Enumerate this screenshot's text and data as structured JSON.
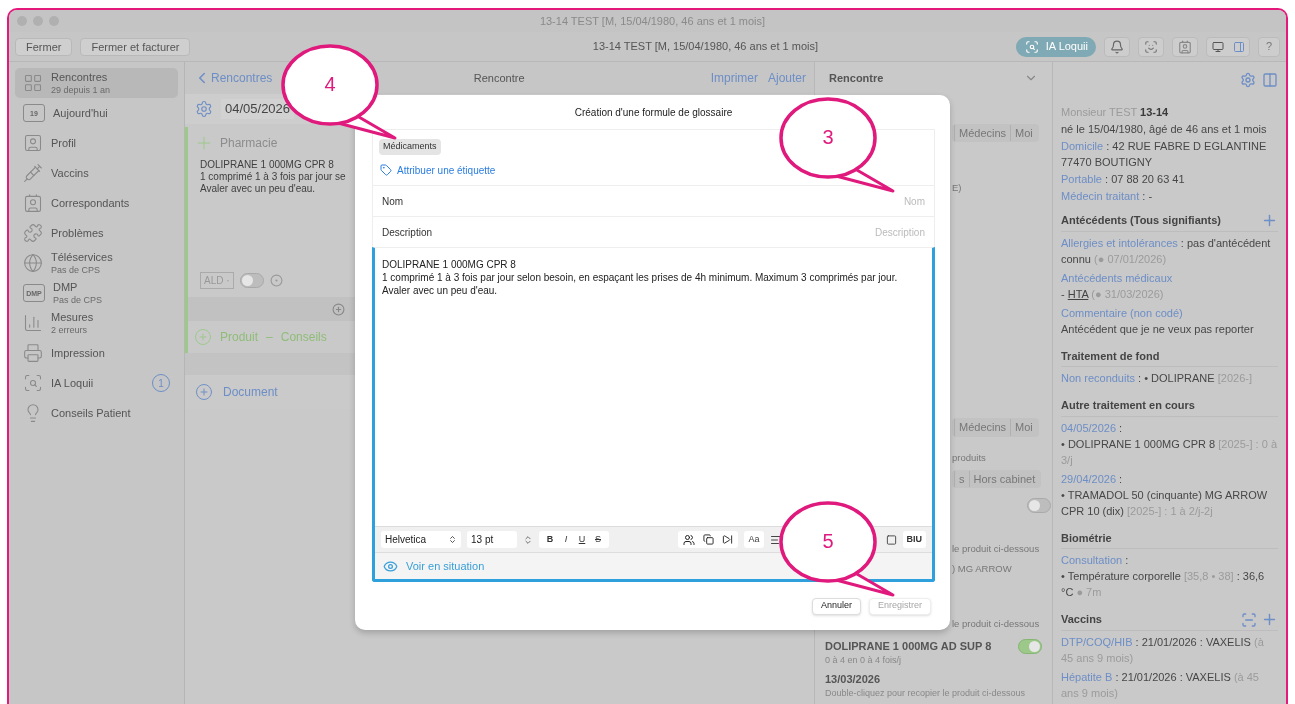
{
  "window": {
    "title": "13-14 TEST [M, 15/04/1980, 46 ans et 1 mois]"
  },
  "toolbar": {
    "buttons": [
      "Fermer",
      "Fermer et facturer"
    ],
    "title": "13-14 TEST [M, 15/04/1980, 46 ans et 1 mois]",
    "assistant": "IA Loquii",
    "help": "?"
  },
  "sidebar": {
    "items": [
      {
        "label": "Rencontres",
        "sub": "29 depuis 1 an",
        "selected": true
      },
      {
        "label": "Aujourd'hui",
        "icon_text": "19",
        "selected": false
      },
      {
        "label": "Profil",
        "selected": false
      },
      {
        "label": "Vaccins",
        "selected": false
      },
      {
        "label": "Correspondants",
        "selected": false
      },
      {
        "label": "Problèmes",
        "selected": false
      },
      {
        "label": "Téléservices",
        "sub": "Pas de CPS",
        "selected": false
      },
      {
        "label": "DMP",
        "sub": "Pas de CPS",
        "icon_text": "DMP",
        "selected": false
      },
      {
        "label": "Mesures",
        "sub": "2 erreurs",
        "selected": false
      },
      {
        "label": "Impression",
        "selected": false
      },
      {
        "label": "IA Loquii",
        "badge": "1",
        "selected": false
      },
      {
        "label": "Conseils Patient",
        "selected": false
      }
    ]
  },
  "encounter": {
    "back": "Rencontres",
    "title": "Rencontre",
    "actions": [
      "Imprimer",
      "Ajouter"
    ],
    "date": "04/05/2026",
    "card": {
      "title": "Pharmacie",
      "lines": [
        "DOLIPRANE 1 000MG CPR 8",
        "1 comprimé 1 à 3 fois par jour se",
        "Avaler avec un peu d'eau."
      ],
      "ald": "ALD ·",
      "toggle_on": false
    },
    "product": "Produit",
    "dash": "–",
    "advice": "Conseils",
    "document": "Document"
  },
  "column_2": {
    "title": "Rencontre",
    "fragments": [
      {
        "kind": "segmented",
        "items": [
          "Médecins",
          "Moi"
        ]
      },
      {
        "kind": "text",
        "text": "E)"
      },
      {
        "kind": "segmented",
        "items": [
          "Médecins",
          "Moi"
        ]
      },
      {
        "kind": "text",
        "text": "produits"
      },
      {
        "kind": "segmented",
        "items": [
          "s",
          "Hors cabinet"
        ]
      },
      {
        "kind": "toggle",
        "on": false
      },
      {
        "kind": "text",
        "text": "le produit ci-dessous"
      },
      {
        "kind": "text",
        "text": ") MG ARROW"
      },
      {
        "kind": "text",
        "text": "le produit ci-dessous"
      }
    ],
    "items": [
      {
        "title": "DOLIPRANE 1 000MG AD SUP 8",
        "detail": "0 à 4 en 0 à 4 fois/j",
        "toggle_on": true
      },
      {
        "title": "13/03/2026",
        "detail": "Double-cliquez pour recopier le produit ci-dessous"
      }
    ]
  },
  "patient": {
    "header": [
      [
        {
          "text": "Monsieur TEST ",
          "kind": "muted"
        },
        {
          "text": "13-14",
          "kind": "strong"
        }
      ],
      [
        {
          "text": "né le 15/04/1980, âgé de 46 ans et 1 mois",
          "kind": "normal"
        }
      ],
      [
        {
          "text": "Domicile",
          "kind": "link"
        },
        {
          "text": " : 42 RUE FABRE D EGLANTINE 77470 BOUTIGNY",
          "kind": "normal"
        }
      ],
      [
        {
          "text": "Portable",
          "kind": "link"
        },
        {
          "text": " : 07 88 20 63 41",
          "kind": "normal"
        }
      ],
      [
        {
          "text": "Médecin traitant",
          "kind": "link"
        },
        {
          "text": " : -",
          "kind": "normal"
        }
      ]
    ],
    "sections": [
      {
        "title": "Antécédents (Tous signifiants)",
        "add_button": true,
        "scan_button": false,
        "entries": [
          [
            [
              {
                "text": "Allergies et intolérances",
                "kind": "link"
              },
              {
                "text": " : pas d'antécédent connu",
                "kind": "normal"
              },
              {
                "text": " (● 07/01/2026)",
                "kind": "muted"
              }
            ]
          ],
          [
            [
              {
                "text": "Antécédents médicaux",
                "kind": "link"
              }
            ],
            [
              {
                "text": "- ",
                "kind": "normal"
              },
              {
                "text": "HTA",
                "kind": "underline"
              },
              {
                "text": " (● 31/03/2026)",
                "kind": "muted"
              }
            ]
          ],
          [
            [
              {
                "text": "Commentaire (non codé)",
                "kind": "link"
              }
            ],
            [
              {
                "text": "Antécédent que je ne veux pas reporter",
                "kind": "normal"
              }
            ]
          ]
        ]
      },
      {
        "title": "Traitement de fond",
        "add_button": false,
        "scan_button": false,
        "entries": [
          [
            [
              {
                "text": "Non reconduits",
                "kind": "link"
              },
              {
                "text": " : • DOLIPRANE ",
                "kind": "normal"
              },
              {
                "text": "[2026-]",
                "kind": "muted"
              }
            ]
          ]
        ]
      },
      {
        "title": "Autre traitement en cours",
        "add_button": false,
        "scan_button": false,
        "entries": [
          [
            [
              {
                "text": "04/05/2026",
                "kind": "link"
              },
              {
                "text": " :",
                "kind": "normal"
              }
            ],
            [
              {
                "text": "• DOLIPRANE 1 000MG CPR 8 ",
                "kind": "normal"
              },
              {
                "text": "[2025-] : 0 à 3/j",
                "kind": "muted"
              }
            ]
          ],
          [
            [
              {
                "text": "29/04/2026",
                "kind": "link"
              },
              {
                "text": " :",
                "kind": "normal"
              }
            ],
            [
              {
                "text": "• TRAMADOL 50 (cinquante) MG ARROW CPR 10 (dix) ",
                "kind": "normal"
              },
              {
                "text": "[2025-] : 1 à 2/j-2j",
                "kind": "muted"
              }
            ]
          ]
        ]
      },
      {
        "title": "Biométrie",
        "add_button": false,
        "scan_button": false,
        "entries": [
          [
            [
              {
                "text": "Consultation",
                "kind": "link"
              },
              {
                "text": " :",
                "kind": "normal"
              }
            ],
            [
              {
                "text": "• Température corporelle ",
                "kind": "normal"
              },
              {
                "text": "[35,8 • 38]",
                "kind": "muted"
              },
              {
                "text": " : 36,6 °C ",
                "kind": "normal"
              },
              {
                "text": "● 7m",
                "kind": "muted"
              }
            ]
          ]
        ]
      },
      {
        "title": "Vaccins",
        "add_button": true,
        "scan_button": true,
        "entries": [
          [
            [
              {
                "text": "DTP/COQ/HIB",
                "kind": "link"
              },
              {
                "text": " : 21/01/2026 : VAXELIS ",
                "kind": "normal"
              },
              {
                "text": "(à 45 ans 9 mois)",
                "kind": "muted"
              }
            ]
          ],
          [
            [
              {
                "text": "Hépatite B",
                "kind": "link"
              },
              {
                "text": " : 21/01/2026 : VAXELIS ",
                "kind": "normal"
              },
              {
                "text": "(à 45 ans 9 mois)",
                "kind": "muted"
              }
            ]
          ]
        ]
      }
    ]
  },
  "dialog": {
    "title": "Création d'une formule de glossaire",
    "tag": "Médicaments",
    "tag_link": "Attribuer une étiquette",
    "fields": [
      {
        "label": "Nom",
        "placeholder": "Nom"
      },
      {
        "label": "Description",
        "placeholder": "Description"
      }
    ],
    "body": [
      "DOLIPRANE 1 000MG CPR 8",
      "1 comprimé 1 à 3 fois par jour selon besoin, en espaçant les prises de 4h minimum. Maximum 3 comprimés par jour.",
      "Avaler avec un peu d'eau."
    ],
    "font": "Helvetica",
    "size": "13 pt",
    "styles": [
      "B",
      "I",
      "U",
      "S"
    ],
    "case_button": "Aa",
    "style_button": "BIU",
    "preview": "Voir en situation",
    "buttons": [
      {
        "label": "Annuler",
        "disabled": false
      },
      {
        "label": "Enregistrer",
        "disabled": true
      }
    ]
  },
  "callouts": [
    {
      "number": "4"
    },
    {
      "number": "3"
    },
    {
      "number": "5"
    }
  ]
}
